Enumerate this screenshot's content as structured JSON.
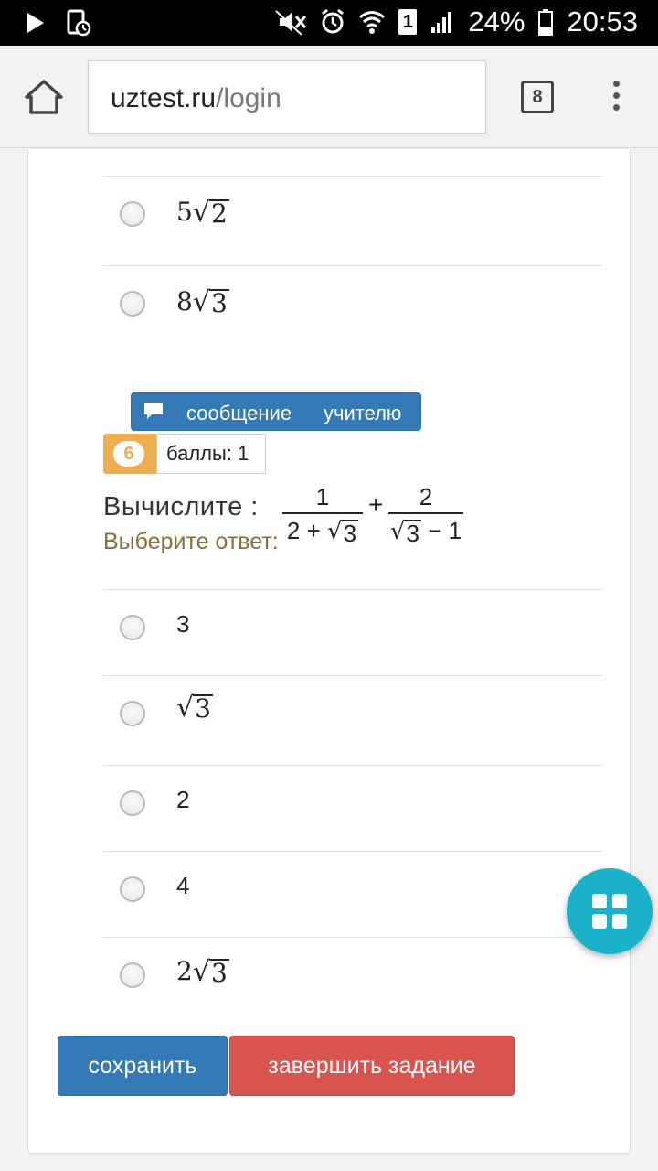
{
  "status_bar": {
    "battery": "24%",
    "time": "20:53",
    "sim_slot": "1"
  },
  "browser": {
    "url_host": "uztest.ru",
    "url_path": "/login",
    "tab_count": "8"
  },
  "prev_question": {
    "options": [
      {
        "coef": "5",
        "radicand": "2"
      },
      {
        "coef": "8",
        "radicand": "3"
      }
    ]
  },
  "message_button": {
    "label_part1": "сообщение",
    "label_part2": "учителю"
  },
  "question": {
    "number": "6",
    "points": "баллы: 1",
    "prompt": "Вычислите :",
    "fraction1": {
      "numerator": "1",
      "denominator_a": "2 +",
      "denominator_radicand": "3",
      "denominator_b": ""
    },
    "plus": "+",
    "fraction2": {
      "numerator": "2",
      "denominator_a": "",
      "denominator_radicand": "3",
      "denominator_b": "− 1"
    },
    "choose_label": "Выберите ответ:",
    "options": [
      {
        "text": "3"
      },
      {
        "coef": "",
        "radicand": "3"
      },
      {
        "text": "2"
      },
      {
        "text": "4"
      },
      {
        "coef": "2",
        "radicand": "3"
      }
    ]
  },
  "actions": {
    "save": "сохранить",
    "finish": "завершить задание"
  },
  "fab": {
    "icon": "grid-icon"
  },
  "colors": {
    "primary": "#337ab7",
    "danger": "#d9534f",
    "warning": "#f0ad4e",
    "fab": "#1ab2c8",
    "choose_label": "#8a6d3b"
  }
}
